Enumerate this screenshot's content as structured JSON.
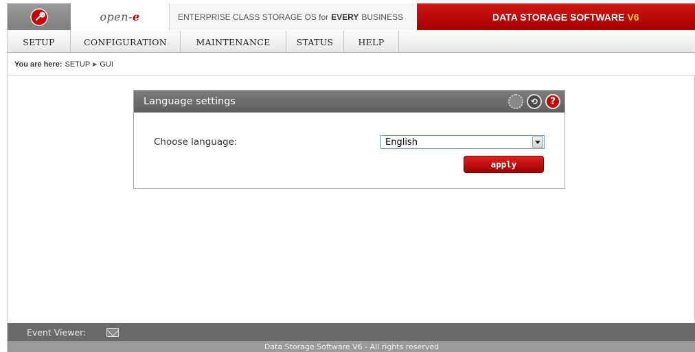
{
  "header": {
    "brand_prefix": "open-",
    "brand_suffix": "e",
    "tagline_pre": "ENTERPRISE CLASS STORAGE OS for",
    "tagline_bold": "EVERY",
    "tagline_post": "BUSINESS",
    "product": "DATA STORAGE SOFTWARE",
    "product_version": "V6",
    "logo_icon": "wrench-icon"
  },
  "menu": {
    "items": [
      {
        "label": "SETUP"
      },
      {
        "label": "CONFIGURATION"
      },
      {
        "label": "MAINTENANCE"
      },
      {
        "label": "STATUS"
      },
      {
        "label": "HELP"
      }
    ]
  },
  "breadcrumb": {
    "prefix": "You are here:",
    "items": [
      "SETUP",
      "GUI"
    ]
  },
  "panel": {
    "title": "Language settings",
    "icons": [
      "settings-icon",
      "refresh-icon",
      "help-icon"
    ],
    "help_glyph": "?",
    "refresh_glyph": "⟲",
    "choose_label": "Choose language:",
    "selected_language": "English",
    "apply_label": "apply"
  },
  "footer": {
    "event_viewer_label": "Event Viewer:",
    "copyright": "Data Storage Software V6 - All rights reserved"
  },
  "colors": {
    "brand_red": "#b00000",
    "header_gray": "#6a6a6a",
    "version_accent": "#ffcc33"
  }
}
